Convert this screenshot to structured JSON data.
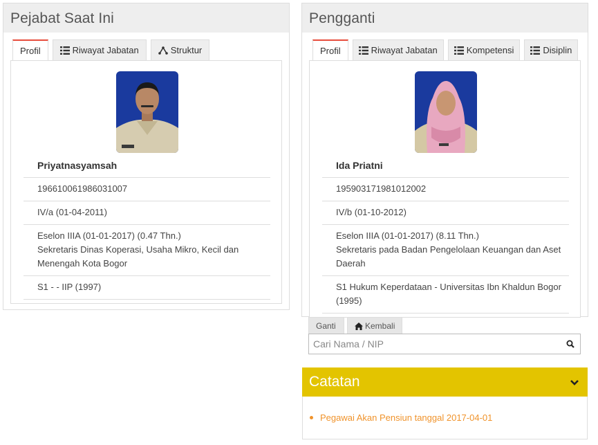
{
  "left_panel": {
    "title": "Pejabat Saat Ini",
    "tabs": [
      {
        "label": "Profil",
        "icon": "none",
        "active": true
      },
      {
        "label": "Riwayat Jabatan",
        "icon": "list-icon",
        "active": false
      },
      {
        "label": "Struktur",
        "icon": "sitemap-icon",
        "active": false
      }
    ],
    "profile": {
      "name": "Priyatnasyamsah",
      "nip": "196610061986031007",
      "golongan": "IV/a (01-04-2011)",
      "eselon": "Eselon IIIA (01-01-2017) (0.47 Thn.)",
      "jabatan": "Sekretaris Dinas Koperasi, Usaha Mikro, Kecil dan Menengah Kota Bogor",
      "pendidikan": "S1 - - IIP (1997)"
    }
  },
  "right_panel": {
    "title": "Pengganti",
    "tabs": [
      {
        "label": "Profil",
        "icon": "none",
        "active": true
      },
      {
        "label": "Riwayat Jabatan",
        "icon": "list-icon",
        "active": false
      },
      {
        "label": "Kompetensi",
        "icon": "list-icon",
        "active": false
      },
      {
        "label": "Disiplin",
        "icon": "list-icon",
        "active": false
      }
    ],
    "profile": {
      "name": "Ida Priatni",
      "nip": "195903171981012002",
      "golongan": "IV/b (01-10-2012)",
      "eselon": "Eselon IIIA (01-01-2017) (8.11 Thn.)",
      "jabatan": "Sekretaris pada Badan Pengelolaan Keuangan dan Aset Daerah",
      "pendidikan": "S1 Hukum Keperdataan - Universitas Ibn Khaldun Bogor (1995)"
    },
    "buttons": {
      "ganti": "Ganti",
      "kembali": "Kembali"
    },
    "search": {
      "placeholder": "Cari Nama / NIP",
      "value": ""
    }
  },
  "catatan": {
    "title": "Catatan",
    "items": [
      "Pegawai Akan Pensiun tanggal 2017-04-01"
    ]
  },
  "colors": {
    "tab_accent": "#e74c3c",
    "catatan_header": "#e3c400",
    "note_text": "#f0932b"
  }
}
